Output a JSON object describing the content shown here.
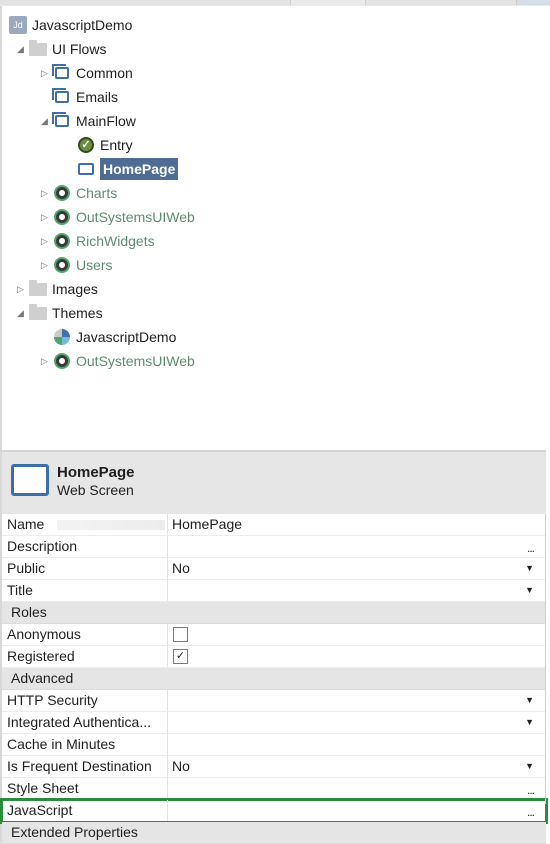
{
  "tree": {
    "app": {
      "label": "JavascriptDemo",
      "icon_text": "Jd"
    },
    "nodes": [
      {
        "label": "UI Flows",
        "icon": "folder-icon"
      },
      {
        "label": "Common",
        "icon": "flow-icon"
      },
      {
        "label": "Emails",
        "icon": "flow-icon"
      },
      {
        "label": "MainFlow",
        "icon": "flow-icon"
      },
      {
        "label": "Entry",
        "icon": "entry-icon"
      },
      {
        "label": "HomePage",
        "icon": "screen-icon"
      },
      {
        "label": "Charts",
        "icon": "module-icon"
      },
      {
        "label": "OutSystemsUIWeb",
        "icon": "module-icon"
      },
      {
        "label": "RichWidgets",
        "icon": "module-icon"
      },
      {
        "label": "Users",
        "icon": "module-icon"
      },
      {
        "label": "Images",
        "icon": "folder-icon"
      },
      {
        "label": "Themes",
        "icon": "folder-icon"
      },
      {
        "label": "JavascriptDemo",
        "icon": "theme-icon"
      },
      {
        "label": "OutSystemsUIWeb",
        "icon": "module-icon"
      }
    ]
  },
  "header": {
    "title": "HomePage",
    "subtitle": "Web Screen"
  },
  "properties": {
    "name": {
      "label": "Name",
      "value": "HomePage"
    },
    "description": {
      "label": "Description",
      "ellipsis": "..."
    },
    "public": {
      "label": "Public",
      "value": "No"
    },
    "title": {
      "label": "Title"
    },
    "roles_section": "Roles",
    "anonymous": {
      "label": "Anonymous",
      "checked": false
    },
    "registered": {
      "label": "Registered",
      "checked": true,
      "mark": "✓"
    },
    "advanced_section": "Advanced",
    "http_security": {
      "label": "HTTP Security"
    },
    "integrated_auth": {
      "label": "Integrated Authentica..."
    },
    "cache": {
      "label": "Cache in Minutes"
    },
    "frequent_destination": {
      "label": "Is Frequent Destination",
      "value": "No"
    },
    "style_sheet": {
      "label": "Style Sheet",
      "ellipsis": "..."
    },
    "javascript": {
      "label": "JavaScript",
      "ellipsis": "..."
    },
    "extended_section": "Extended Properties"
  },
  "colors": {
    "selection": "#4f6d94",
    "highlight_border": "#2e8b3e",
    "module_text": "#5b8c6e"
  }
}
